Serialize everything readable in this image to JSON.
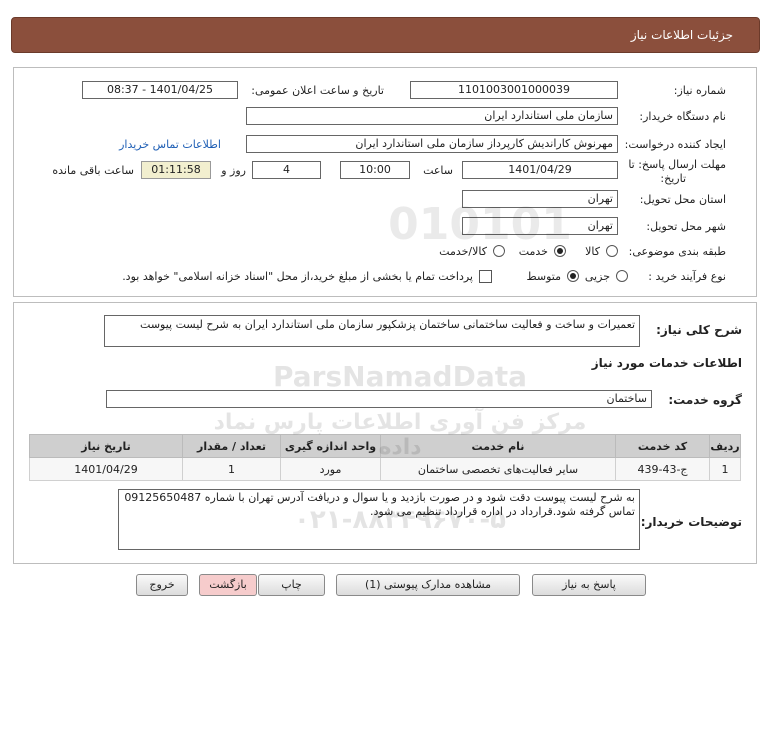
{
  "header": {
    "title": "جزئیات اطلاعات نیاز"
  },
  "form": {
    "need_number_label": "شماره نیاز:",
    "need_number": "1101003001000039",
    "announce_label": "تاریخ و ساعت اعلان عمومی:",
    "announce_value": "1401/04/25 - 08:37",
    "buyer_org_label": "نام دستگاه خریدار:",
    "buyer_org": "سازمان ملی استاندارد ایران",
    "creator_label": "ایجاد کننده درخواست:",
    "creator": "مهرنوش کاراندیش کارپرداز سازمان ملی استاندارد ایران",
    "contact_link": "اطلاعات تماس خریدار",
    "deadline_label_1": "مهلت ارسال پاسخ: تا",
    "deadline_label_2": "تاریخ:",
    "deadline_date": "1401/04/29",
    "time_label": "ساعت",
    "deadline_time": "10:00",
    "days_value": "4",
    "days_label": "روز و",
    "remaining_time": "01:11:58",
    "remaining_label": "ساعت باقی مانده",
    "province_label": "استان محل تحویل:",
    "province": "تهران",
    "city_label": "شهر محل تحویل:",
    "city": "تهران",
    "category_label": "طبقه بندی موضوعی:",
    "category_options": [
      "کالا",
      "خدمت",
      "کالا/خدمت"
    ],
    "category_selected": "خدمت",
    "process_label": "نوع فرآیند خرید :",
    "process_options": [
      "جزیی",
      "متوسط"
    ],
    "process_selected": "متوسط",
    "payment_text": "پرداخت تمام یا بخشی از مبلغ خرید،از محل \"اسناد خزانه اسلامی\" خواهد بود."
  },
  "details": {
    "summary_label": "شرح کلی نیاز:",
    "summary": "تعمیرات و ساخت و فعالیت ساختمانی ساختمان پزشکپور سازمان ملی استاندارد ایران به شرح لیست پیوست",
    "services_heading": "اطلاعات خدمات مورد نیاز",
    "group_label": "گروه خدمت:",
    "group_value": "ساختمان",
    "table_headers": [
      "ردیف",
      "کد خدمت",
      "نام خدمت",
      "واحد اندازه گیری",
      "تعداد / مقدار",
      "تاریخ نیاز"
    ],
    "table_row": [
      "1",
      "ج-43-439",
      "سایر فعالیت‌های تخصصی ساختمان",
      "مورد",
      "1",
      "1401/04/29"
    ],
    "buyer_notes_label": "توضیحات خریدار:",
    "buyer_notes": "به شرح لیست پیوست دقت شود و در صورت بازدید و یا سوال و دریافت آدرس تهران با شماره 09125650487 تماس گرفته شود.قرارداد در اداره قرارداد تنظیم می شود."
  },
  "buttons": {
    "reply": "پاسخ به نیاز",
    "attachments": "مشاهده مدارک پیوستی (1)",
    "print": "چاپ",
    "back": "بازگشت",
    "exit": "خروج"
  },
  "watermark": {
    "brand": "ParsNamadData",
    "tagline": "مرکز فن آوری اطلاعات پارس نماد داده",
    "phone": "۰۲۱-۸۸۳۴۹۶۷۰-۵",
    "code": "010101"
  },
  "colors": {
    "header_bg": "#8b4f3c",
    "link": "#1f5fb5",
    "time_bg": "#f2efcf"
  }
}
